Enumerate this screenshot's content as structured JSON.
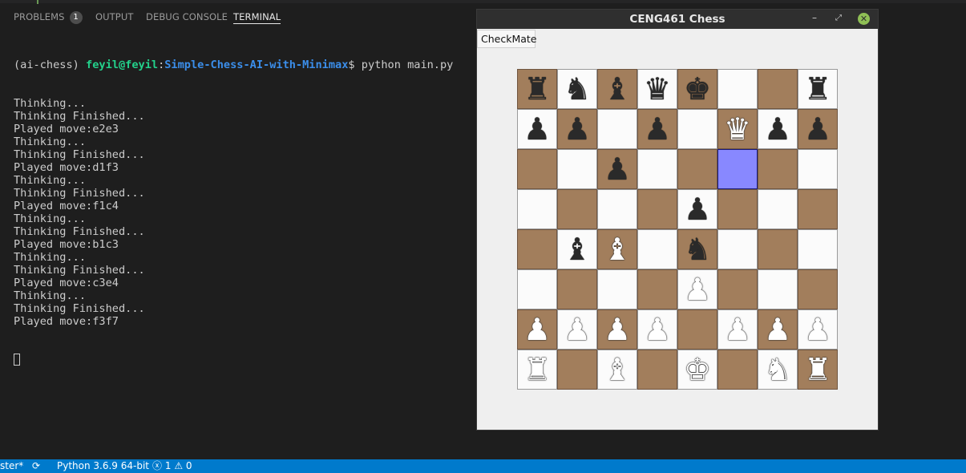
{
  "panel": {
    "tabs": [
      {
        "label": "PROBLEMS",
        "badge": "1"
      },
      {
        "label": "OUTPUT"
      },
      {
        "label": "DEBUG CONSOLE"
      },
      {
        "label": "TERMINAL",
        "active": true
      }
    ]
  },
  "terminal": {
    "prompt": {
      "env": "(ai-chess) ",
      "user": "feyil@feyil",
      "sep": ":",
      "path": "Simple-Chess-AI-with-Minimax",
      "dollar": "$ ",
      "command": "python main.py"
    },
    "lines": [
      "Thinking...",
      "Thinking Finished...",
      "Played move:e2e3",
      "Thinking...",
      "Thinking Finished...",
      "Played move:d1f3",
      "Thinking...",
      "Thinking Finished...",
      "Played move:f1c4",
      "Thinking...",
      "Thinking Finished...",
      "Played move:b1c3",
      "Thinking...",
      "Thinking Finished...",
      "Played move:c3e4",
      "Thinking...",
      "Thinking Finished...",
      "Played move:f3f7"
    ]
  },
  "chess_window": {
    "title": "CENG461 Chess",
    "minimize_glyph": "–",
    "maximize_glyph": "⤢",
    "close_glyph": "✕",
    "checkmate_label": "CheckMate",
    "highlight_square": "f6",
    "board": [
      [
        "bR",
        "bN",
        "bB",
        "bQ",
        "bK",
        "",
        "",
        "bR"
      ],
      [
        "bP",
        "bP",
        "",
        "bP",
        "",
        "wQ",
        "bP",
        "bP"
      ],
      [
        "",
        "",
        "bP",
        "",
        "",
        "",
        "",
        ""
      ],
      [
        "",
        "",
        "",
        "",
        "bP",
        "",
        "",
        ""
      ],
      [
        "",
        "bB",
        "wB",
        "",
        "bN",
        "",
        "",
        ""
      ],
      [
        "",
        "",
        "",
        "",
        "wP",
        "",
        "",
        ""
      ],
      [
        "wP",
        "wP",
        "wP",
        "wP",
        "",
        "wP",
        "wP",
        "wP"
      ],
      [
        "wR",
        "",
        "wB",
        "",
        "wK",
        "",
        "wN",
        "wR"
      ]
    ]
  },
  "statusbar": {
    "branch": "ster*",
    "sync_icon": "⟳",
    "python": "Python 3.6.9 64-bit",
    "errors": "1",
    "warnings": "0",
    "error_icon": "ⓧ",
    "warning_icon": "⚠"
  }
}
